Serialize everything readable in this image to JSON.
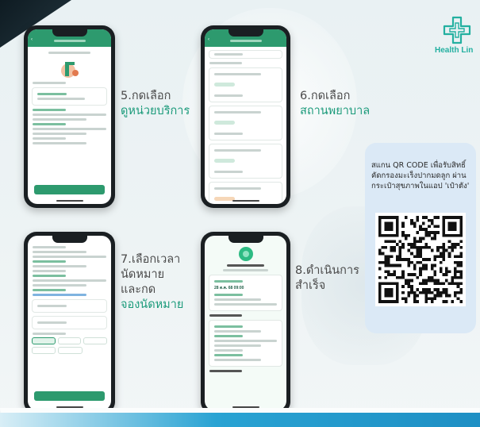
{
  "brand": {
    "logo_text": "Health Lin",
    "accent": "#23b0a0",
    "primary_green": "#2d9a6e"
  },
  "steps": [
    {
      "number_label": "5.กดเลือก",
      "accent_label": "ดูหน่วยบริการ"
    },
    {
      "number_label": "6.กดเลือก",
      "accent_label": "สถานพยาบาล"
    },
    {
      "number_label": "7.เลือกเวลา",
      "line2": "นัดหมาย",
      "line3": "และกด",
      "accent_label": "จองนัดหมาย"
    },
    {
      "number_label": "8.ดำเนินการ",
      "line2": "สำเร็จ"
    }
  ],
  "qr_panel": {
    "text": "สแกน QR CODE เพื่อรับสิทธิ์คัดกรองมะเร็งปากมดลูก ผ่านกระเป๋าสุขภาพในแอป 'เป๋าตัง'",
    "icon": "qr-code"
  },
  "phone_screens": {
    "p8_date": "28 ต.ค. 68 09:00"
  }
}
